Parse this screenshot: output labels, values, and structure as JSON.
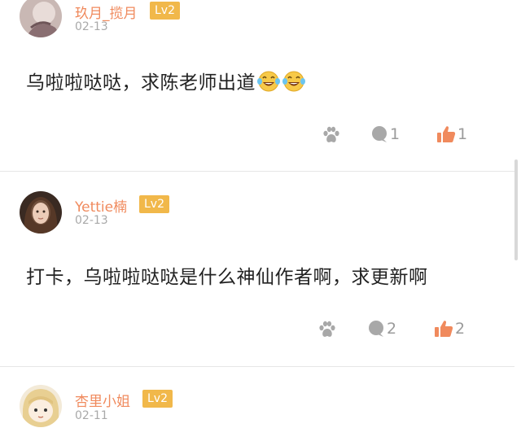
{
  "comments": [
    {
      "username": "玖月_揽月",
      "level": "Lv2",
      "date": "02-13",
      "text": "乌啦啦哒哒，求陈老师出道",
      "emoji": [
        "laughing-crying-emoji",
        "laughing-crying-emoji"
      ],
      "reply_count": "1",
      "like_count": "1"
    },
    {
      "username": "Yettie楠",
      "level": "Lv2",
      "date": "02-13",
      "text": "打卡，乌啦啦哒哒是什么神仙作者啊，求更新啊",
      "reply_count": "2",
      "like_count": "2"
    },
    {
      "username": "杏里小姐",
      "level": "Lv2",
      "date": "02-11"
    }
  ],
  "colors": {
    "username": "#f08a5d",
    "badge": "#f1b84a",
    "like_icon": "#f08a5d",
    "muted": "#9b9b9b"
  },
  "icons": {
    "paw": "paw-icon",
    "reply": "comment-bubble-icon",
    "like": "thumbs-up-icon"
  }
}
